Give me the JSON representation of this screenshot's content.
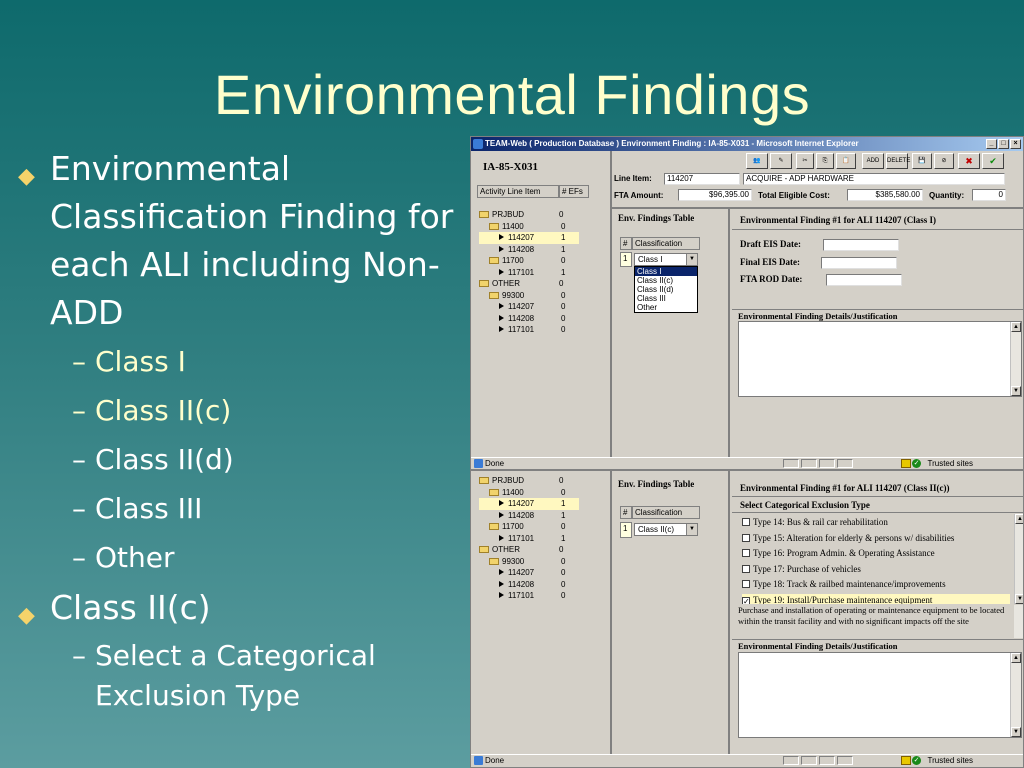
{
  "slide": {
    "title": "Environmental Findings",
    "bullets": [
      {
        "text": "Environmental Classification Finding for each ALI including Non-ADD",
        "subs": [
          "Class I",
          "Class II(c)",
          "Class II(d)",
          "Class III",
          "Other"
        ]
      },
      {
        "text": "Class II(c)",
        "subs": [
          "Select a Categorical Exclusion Type"
        ]
      }
    ]
  },
  "browser": {
    "title": "TEAM-Web ( Production Database ) Environment Finding : IA-85-X031 - Microsoft Internet Explorer",
    "status": "Done",
    "zone": "Trusted sites",
    "win_min": "_",
    "win_max": "□",
    "win_close": "×"
  },
  "project_id": "IA-85-X031",
  "left_tabs": {
    "activity": "Activity Line Item",
    "efs": "# EFs"
  },
  "tree": [
    {
      "label": "PRJBUD",
      "count": "0",
      "type": "folder",
      "level": 0
    },
    {
      "label": "11400",
      "count": "0",
      "type": "folder",
      "level": 1
    },
    {
      "label": "114207",
      "count": "1",
      "type": "item",
      "level": 2,
      "selected": true
    },
    {
      "label": "114208",
      "count": "1",
      "type": "item",
      "level": 2
    },
    {
      "label": "11700",
      "count": "0",
      "type": "folder",
      "level": 1
    },
    {
      "label": "117101",
      "count": "1",
      "type": "item",
      "level": 2
    },
    {
      "label": "OTHER",
      "count": "0",
      "type": "folder",
      "level": 0
    },
    {
      "label": "99300",
      "count": "0",
      "type": "folder",
      "level": 1
    },
    {
      "label": "114207",
      "count": "0",
      "type": "item",
      "level": 2
    },
    {
      "label": "114208",
      "count": "0",
      "type": "item",
      "level": 2
    },
    {
      "label": "117101",
      "count": "0",
      "type": "item",
      "level": 2
    }
  ],
  "toolbar": {
    "add": "ADD",
    "delete": "DELETE",
    "cancel": "CANCEL",
    "ok": "OK"
  },
  "header": {
    "line_item_label": "Line Item:",
    "line_item_value": "114207",
    "description": "ACQUIRE - ADP HARDWARE",
    "fta_amount_label": "FTA Amount:",
    "fta_amount_value": "$96,395.00",
    "total_eligible_label": "Total Eligible Cost:",
    "total_eligible_value": "$385,580.00",
    "quantity_label": "Quantity:",
    "quantity_value": "0"
  },
  "ef_table": {
    "title": "Env. Findings Table",
    "col_num": "#",
    "col_class": "Classification",
    "row_num": "1"
  },
  "top": {
    "selected_class": "Class I",
    "dropdown_options": [
      "Class I",
      "Class II(c)",
      "Class II(d)",
      "Class III",
      "Other"
    ],
    "finding_title": "Environmental Finding #1 for ALI 114207 (Class I)",
    "draft_eis": "Draft EIS Date:",
    "final_eis": "Final EIS Date:",
    "fta_rod": "FTA ROD Date:",
    "details_label": "Environmental Finding Details/Justification"
  },
  "bottom": {
    "selected_class": "Class II(c)",
    "finding_title": "Environmental Finding #1 for ALI 114207 (Class II(c))",
    "select_label": "Select Categorical Exclusion Type",
    "types": [
      {
        "label": "Type 14: Bus & rail car rehabilitation",
        "checked": false
      },
      {
        "label": "Type 15: Alteration for elderly & persons w/ disabilities",
        "checked": false
      },
      {
        "label": "Type 16: Program Admin. & Operating Assistance",
        "checked": false
      },
      {
        "label": "Type 17: Purchase of vehicles",
        "checked": false
      },
      {
        "label": "Type 18: Track & railbed maintenance/improvements",
        "checked": false
      },
      {
        "label": "Type 19: Install/Purchase maintenance equipment",
        "checked": true
      }
    ],
    "type_description": "Purchase and installation of operating or maintenance equipment to be located within the transit facility and with no significant impacts off the site",
    "details_label": "Environmental Finding Details/Justification"
  }
}
